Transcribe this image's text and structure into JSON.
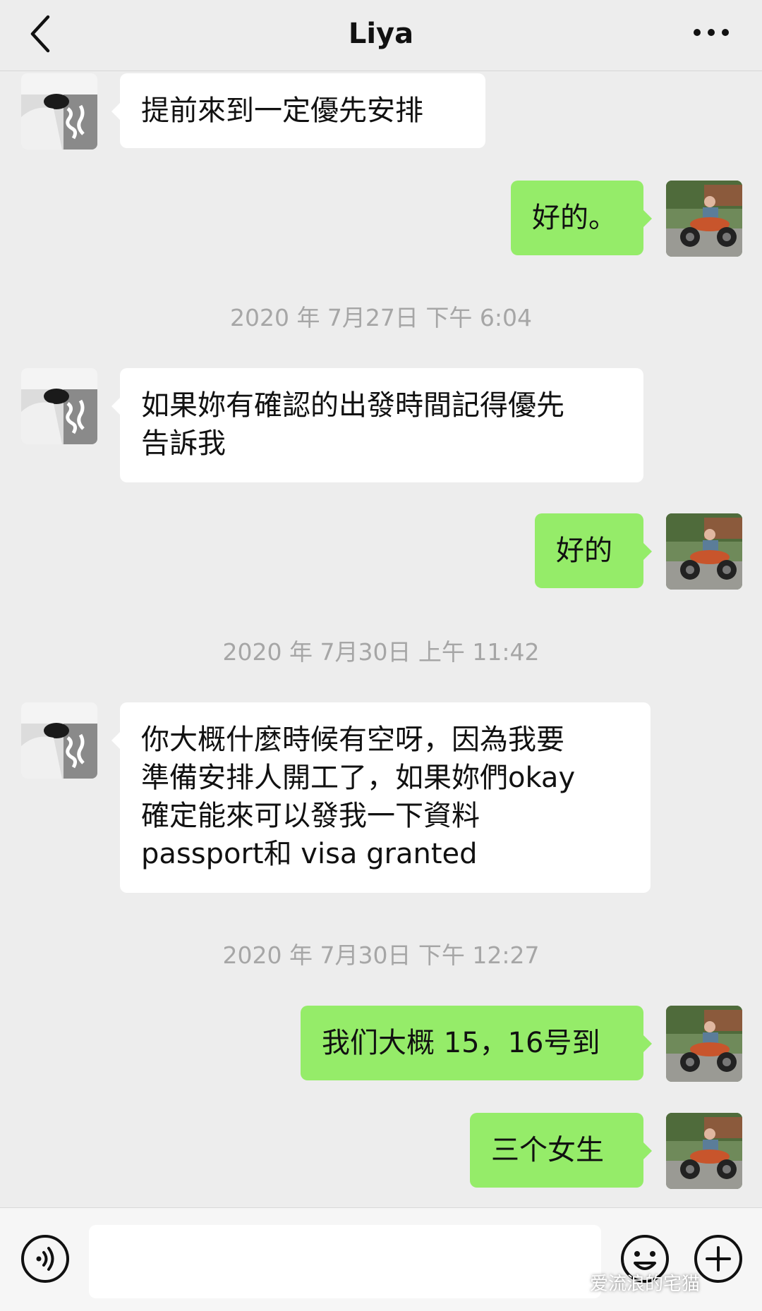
{
  "header": {
    "title": "Liya",
    "back_icon": "chevron-left-icon",
    "more_icon": "more-dots-icon"
  },
  "colors": {
    "background": "#ededed",
    "bubble_incoming": "#ffffff",
    "bubble_outgoing": "#95ec69",
    "timestamp": "#a6a6a6"
  },
  "messages": [
    {
      "from": "contact",
      "text": "提前來到一定優先安排"
    },
    {
      "from": "me",
      "text": "好的。"
    },
    {
      "type": "timestamp",
      "text": "2020 年 7月27日 下午 6:04"
    },
    {
      "from": "contact",
      "line1": "如果妳有確認的出發時間記得優先",
      "line2": "告訴我"
    },
    {
      "from": "me",
      "text": "好的"
    },
    {
      "type": "timestamp",
      "text": "2020 年 7月30日 上午 11:42"
    },
    {
      "from": "contact",
      "line1": "你大概什麼時候有空呀，因為我要",
      "line2": "準備安排人開工了，如果妳們okay",
      "line3": "確定能來可以發我一下資料",
      "line4": "passport和 visa granted"
    },
    {
      "type": "timestamp",
      "text": "2020 年 7月30日 下午 12:27"
    },
    {
      "from": "me",
      "text": "我们大概 15，16号到"
    },
    {
      "from": "me",
      "text": "三个女生"
    }
  ],
  "input_bar": {
    "voice_icon": "voice-icon",
    "input_value": "",
    "emoji_icon": "emoji-icon",
    "plus_icon": "plus-icon"
  },
  "watermark": "爱流浪的宅猫"
}
